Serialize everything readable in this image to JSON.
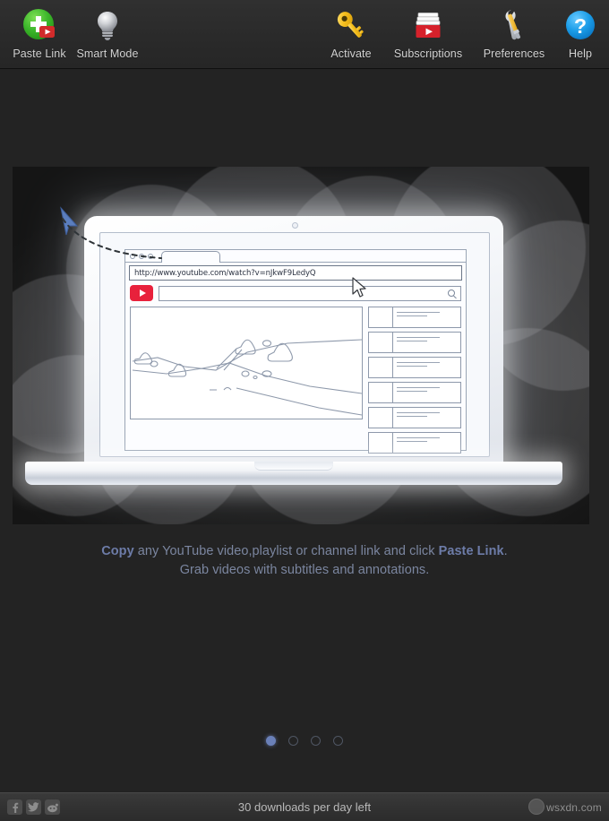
{
  "toolbar": {
    "left_items": [
      {
        "label": "Paste Link",
        "icon": "paste-link-icon"
      },
      {
        "label": "Smart Mode",
        "icon": "lightbulb-icon"
      }
    ],
    "right_items": [
      {
        "label": "Activate",
        "icon": "key-icon"
      },
      {
        "label": "Subscriptions",
        "icon": "subscriptions-tray-icon"
      },
      {
        "label": "Preferences",
        "icon": "tools-icon"
      },
      {
        "label": "Help",
        "icon": "question-mark-icon"
      }
    ]
  },
  "hero": {
    "browser": {
      "url": "http://www.youtube.com/watch?v=nJkwF9LedyQ",
      "search_placeholder": "",
      "logo_icon": "youtube-play-icon",
      "search_icon": "magnifier-icon",
      "tab_dots": 3,
      "sidebar_cards": 6
    },
    "blue_pointer_icon": "blue-arrow-cursor-icon",
    "white_pointer_icon": "white-arrow-cursor-icon",
    "dashed_guide_icon": "dashed-path-icon"
  },
  "caption": {
    "line1_bold_start": "Copy",
    "line1_mid": " any YouTube video,playlist or channel link and click ",
    "line1_bold_end": "Paste Link",
    "line1_period": ".",
    "line2": "Grab videos with subtitles and annotations."
  },
  "pager": {
    "total": 4,
    "active_index": 0
  },
  "statusbar": {
    "social": [
      {
        "name": "facebook-icon",
        "glyph": "f"
      },
      {
        "name": "twitter-icon",
        "glyph": "ᵥ"
      },
      {
        "name": "reddit-icon",
        "glyph": "◕"
      }
    ],
    "status_text": "30 downloads per day left",
    "watermark": "wsxdn.com",
    "watermark_icon": "globe-icon"
  },
  "colors": {
    "accent_blue": "#6a80b8",
    "youtube_red": "#e8213c",
    "toolbar_bg": "#2b2b2b",
    "stage_bg": "#232323",
    "caption_text": "#7b86a0"
  }
}
